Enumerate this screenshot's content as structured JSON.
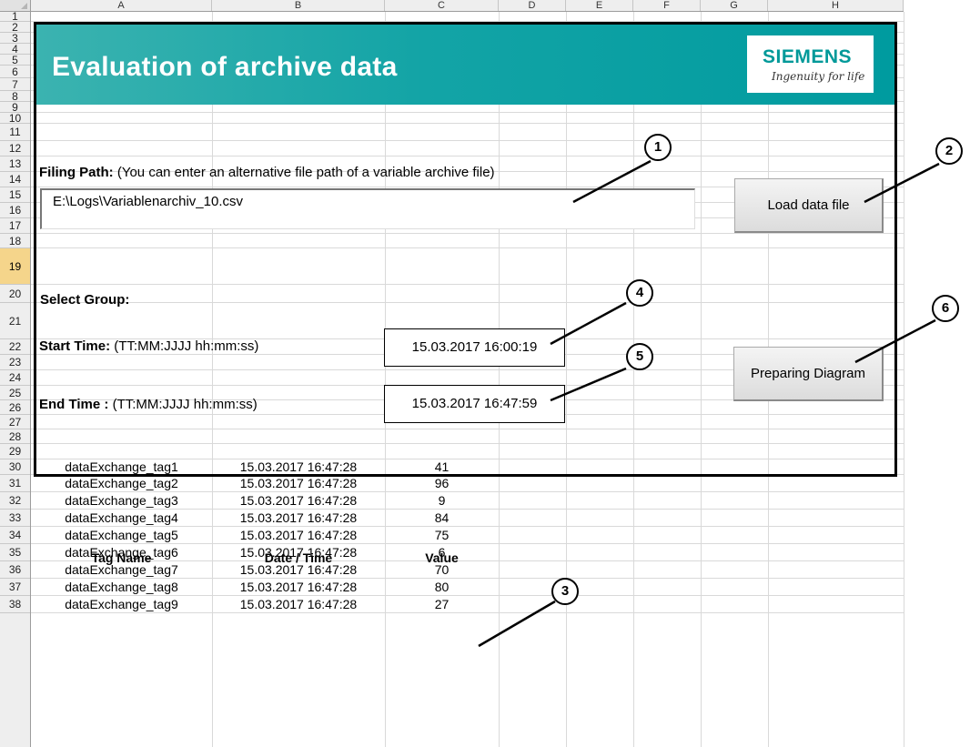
{
  "columns": [
    "A",
    "B",
    "C",
    "D",
    "E",
    "F",
    "G",
    "H"
  ],
  "rows": [
    "1",
    "2",
    "3",
    "4",
    "5",
    "6",
    "7",
    "8",
    "9",
    "10",
    "11",
    "12",
    "13",
    "14",
    "15",
    "16",
    "17",
    "18",
    "19",
    "20",
    "21",
    "22",
    "23",
    "24",
    "25",
    "26",
    "27",
    "28",
    "29",
    "30",
    "31",
    "32",
    "33",
    "34",
    "35",
    "36",
    "37",
    "38"
  ],
  "selected_row": "19",
  "banner": {
    "title": "Evaluation of archive data",
    "logo_word": "SIEMENS",
    "logo_tagline": "Ingenuity for life"
  },
  "filing_path": {
    "label_bold": "Filing Path:",
    "label_rest": " (You can enter an alternative file path of a variable  archive file)",
    "value": "E:\\Logs\\Variablenarchiv_10.csv"
  },
  "buttons": {
    "load": "Load data file",
    "diagram": "Preparing Diagram"
  },
  "select_group": {
    "label": "Select Group:"
  },
  "start_time": {
    "label_bold": "Start Time:",
    "label_rest": " (TT:MM:JJJJ  hh:mm:ss)",
    "value": "15.03.2017 16:00:19"
  },
  "end_time": {
    "label_bold": "End Time :",
    "label_rest": " (TT:MM:JJJJ  hh:mm:ss)",
    "value": "15.03.2017 16:47:59"
  },
  "callouts": [
    "1",
    "2",
    "3",
    "4",
    "5",
    "6"
  ],
  "table": {
    "headers": [
      "Tag Name",
      "Date / Time",
      "Value"
    ],
    "rows": [
      [
        "dataExchange_tag1",
        "15.03.2017 16:47:28",
        "41"
      ],
      [
        "dataExchange_tag2",
        "15.03.2017 16:47:28",
        "96"
      ],
      [
        "dataExchange_tag3",
        "15.03.2017 16:47:28",
        "9"
      ],
      [
        "dataExchange_tag4",
        "15.03.2017 16:47:28",
        "84"
      ],
      [
        "dataExchange_tag5",
        "15.03.2017 16:47:28",
        "75"
      ],
      [
        "dataExchange_tag6",
        "15.03.2017 16:47:28",
        "6"
      ],
      [
        "dataExchange_tag7",
        "15.03.2017 16:47:28",
        "70"
      ],
      [
        "dataExchange_tag8",
        "15.03.2017 16:47:28",
        "80"
      ],
      [
        "dataExchange_tag9",
        "15.03.2017 16:47:28",
        "27"
      ]
    ]
  },
  "colors": {
    "banner_start": "#3bb3b0",
    "banner_end": "#009b9f",
    "logo_teal": "#009999",
    "selected_row": "#f5d58b"
  }
}
